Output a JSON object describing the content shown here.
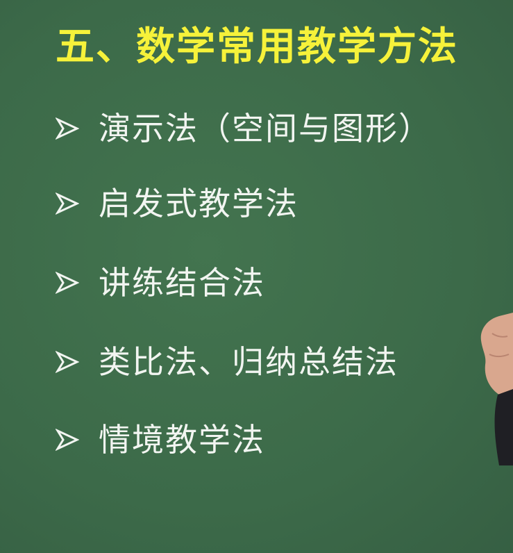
{
  "slide": {
    "title": "五、数学常用教学方法",
    "items": [
      {
        "label": "演示法（空间与图形）"
      },
      {
        "label": "启发式教学法"
      },
      {
        "label": "讲练结合法"
      },
      {
        "label": "类比法、归纳总结法"
      },
      {
        "label": "情境教学法"
      }
    ]
  },
  "colors": {
    "board": "#3d6b4b",
    "title": "#f6f23a",
    "text": "#f2f5f1"
  },
  "icons": {
    "bullet": "arrow-bullet-icon"
  }
}
